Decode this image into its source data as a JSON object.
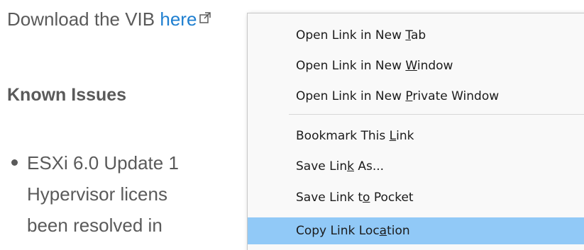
{
  "page": {
    "download_prefix": "Download the VIB ",
    "download_link": "here",
    "heading": "Known Issues",
    "bullet_lines": [
      "ESXi 6.0 Update 1",
      "Hypervisor licens",
      "been resolved in"
    ]
  },
  "context_menu": {
    "items": [
      {
        "before": "Open Link in New ",
        "key": "T",
        "after": "ab"
      },
      {
        "before": "Open Link in New ",
        "key": "W",
        "after": "indow"
      },
      {
        "before": "Open Link in New ",
        "key": "P",
        "after": "rivate Window"
      },
      {
        "before": "Bookmark This ",
        "key": "L",
        "after": "ink"
      },
      {
        "before": "Save Lin",
        "key": "k",
        "after": " As..."
      },
      {
        "before": "Save Link t",
        "key": "o",
        "after": " Pocket"
      },
      {
        "before": "Copy Link Loc",
        "key": "a",
        "after": "tion"
      }
    ],
    "highlighted_index": 6
  },
  "colors": {
    "link": "#1f7fd0",
    "text": "#5a5a5a",
    "menu_highlight": "#91c9f7",
    "menu_background": "#f9f9f9"
  },
  "icons": {
    "external_link": "external-link-icon"
  }
}
